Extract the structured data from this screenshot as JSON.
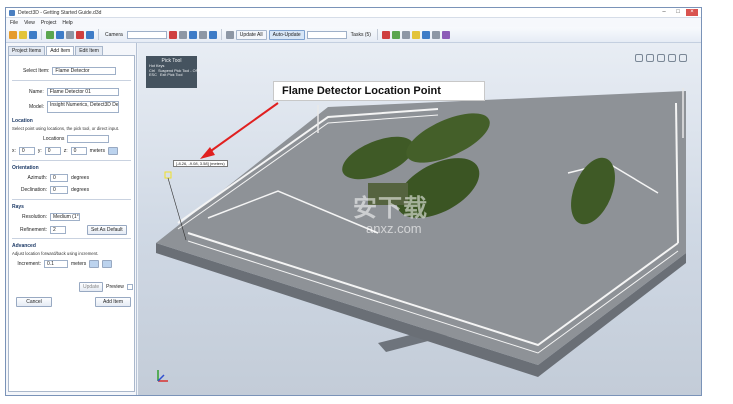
{
  "window": {
    "title": "Detect3D - Getting Started Guide.d3d"
  },
  "menu": [
    "File",
    "View",
    "Project",
    "Help"
  ],
  "toolbar": {
    "camera_label": "Camera",
    "update_all_label": "Update All",
    "auto_update_label": "Auto-Update",
    "tasks_label": "Tasks (5)"
  },
  "left_panel": {
    "tabs": [
      "Project Items",
      "Add Item",
      "Edit Item"
    ],
    "select_item_label": "Select Item:",
    "select_item_value": "Flame Detector",
    "name_label": "Name:",
    "name_value": "Flame Detector 01",
    "model_label": "Model:",
    "model_value": "Insight Numerics, Detect3D Default",
    "location_header": "Location",
    "location_hint": "Select point using locations, the pick tool, or direct input.",
    "locations_label": "Locations",
    "x_label": "x:",
    "x_value": "0",
    "y_label": "y:",
    "y_value": "0",
    "z_label": "z:",
    "z_value": "0",
    "meters_label": "meters",
    "orientation_header": "Orientation",
    "azimuth_label": "Azimuth:",
    "azimuth_value": "0",
    "declination_label": "Declination:",
    "declination_value": "0",
    "degrees_label": "degrees",
    "rays_header": "Rays",
    "resolution_label": "Resolution:",
    "resolution_value": "Medium (1°)",
    "refinement_label": "Refinement:",
    "refinement_value": "2",
    "set_default_label": "Set As Default",
    "advanced_header": "Advanced",
    "advanced_hint": "Adjust location forward/back using increment.",
    "increment_label": "Increment:",
    "increment_value": "0.1",
    "increment_units": "meters",
    "update_label": "Update",
    "preview_label": "Preview",
    "cancel_label": "Cancel",
    "add_item_label": "Add Item"
  },
  "pick_tool": {
    "title": "Pick Tool",
    "hot_keys_label": "Hot Keys",
    "ctrl_key": "Ctrl",
    "ctrl_action": "Suspend Pick Tool - OFF",
    "esc_key": "ESC",
    "esc_action": "Exit Pick Tool"
  },
  "viewport": {
    "callout": "Flame Detector Location Point",
    "coordinate_readout": "[-8.26, -9.08, 3.58] (meters)",
    "watermark": "安下载",
    "watermark_sub": "anxz.com"
  },
  "colors": {
    "accent": "#3e7cc7",
    "deck": "#8e9297",
    "tank": "#3f5a26",
    "arrow": "#e02020",
    "pick_tool_bg": "#45535f"
  }
}
